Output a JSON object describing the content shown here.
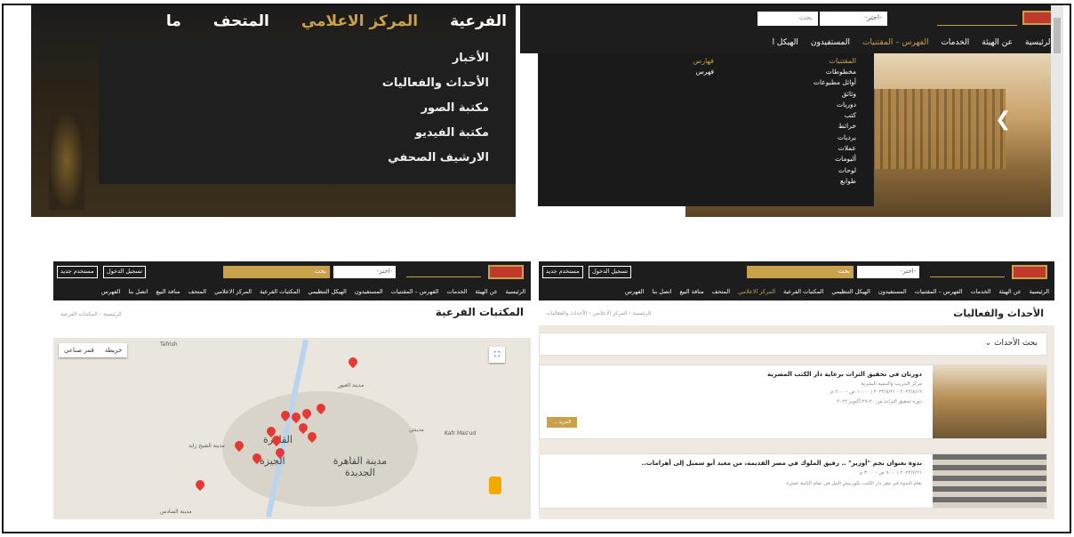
{
  "panel1": {
    "nav": [
      "الفرعية",
      "المركز الاعلامي",
      "المتحف",
      "ما"
    ],
    "dropdown": [
      "الأخبار",
      "الأحداث والفعاليات",
      "مكتبة الصور",
      "مكتبة الفيديو",
      "الارشيف الصحفي"
    ]
  },
  "panel2": {
    "search_placeholder": "بحث",
    "select_value": "-اختر-",
    "nav": [
      "الرئيسية",
      "عن الهيئة",
      "الخدمات",
      "الفهرس – المقتنيات",
      "المستفيدون",
      "الهيكل ا"
    ],
    "mega_col1_head": "المقتنيات",
    "mega_col1": [
      "مخطوطات",
      "أوائل مطبوعات",
      "وثائق",
      "دوريات",
      "كتب",
      "خرائط",
      "برديات",
      "عملات",
      "ألبومات",
      "لوحات",
      "طوابع"
    ],
    "mega_col2_head": "فهارس",
    "mega_col2": [
      "فهرس"
    ]
  },
  "panel3": {
    "select_value": "-اختر-",
    "search_placeholder": "بحث",
    "login": "تسجيل الدخول",
    "new_user": "مستخدم جديد",
    "nav": [
      "الرئيسية",
      "عن الهيئة",
      "الخدمات",
      "الفهرس – المقتنيات",
      "المستفيدون",
      "الهيكل التنظيمي",
      "المكتبات الفرعية",
      "المركز الاعلامي",
      "المتحف",
      "منافذ البيع",
      "اتصل بنا",
      "الفهرس"
    ],
    "title": "المكتبات الفرعية",
    "breadcrumb": "الرئيسية › المكتبات الفرعية",
    "map_type": [
      "خريطة",
      "قمر صناعي"
    ],
    "labels": [
      "مدينة العبور",
      "القاهرة",
      "الجيزة",
      "مدينة القاهرة الجديدة",
      "مدينة الشيخ زايد",
      "مدينة السادس",
      "Kafr Mas'ud",
      "مدينتي",
      "Tafrish"
    ]
  },
  "panel4": {
    "select_value": "-اختر-",
    "search_placeholder": "بحث",
    "login": "تسجيل الدخول",
    "new_user": "مستخدم جديد",
    "nav": [
      "الرئيسية",
      "عن الهيئة",
      "الخدمات",
      "الفهرس – المقتنيات",
      "المستفيدون",
      "الهيكل التنظيمي",
      "المكتبات الفرعية",
      "المركز الاعلامي",
      "المتحف",
      "منافذ البيع",
      "اتصل بنا",
      "الفهرس"
    ],
    "title": "الأحداث والفعاليات",
    "breadcrumb": "الرئيسية › المركز الاعلامي › الأحداث والفعاليات",
    "filter": "بحث الأحداث ⌄",
    "events": [
      {
        "title": "دورتان في تحقيق التراث برعاية دار الكتب المصرية",
        "place": "مركز التدريب والتنمية البشرية",
        "date": "٢٠٢٢/٨/١٩ - ٢٠٢٢/٨/٢١ | ١٠:٠٠ ص - ٢:٠٠ م",
        "desc": "دورة تحقيق التراث من ٢٠-٢٩ أكتوبر ٢٠٢٢",
        "more": "المزيد ..."
      },
      {
        "title": "ندوة بعنوان نجم \"أوزير\" .. رفيق الملوك في مصر القديمة، من معبد أبو سمبل إلى أهرامات..",
        "place": "",
        "date": "٢٠٢٢/٧/٢١ | ٩:٠٠ ص - ٣:٠٠ م",
        "desc": "تقام الندوة في مقر دار الكتب بكورنيش النيل في تمام الثانية عشرة",
        "more": ""
      }
    ]
  }
}
